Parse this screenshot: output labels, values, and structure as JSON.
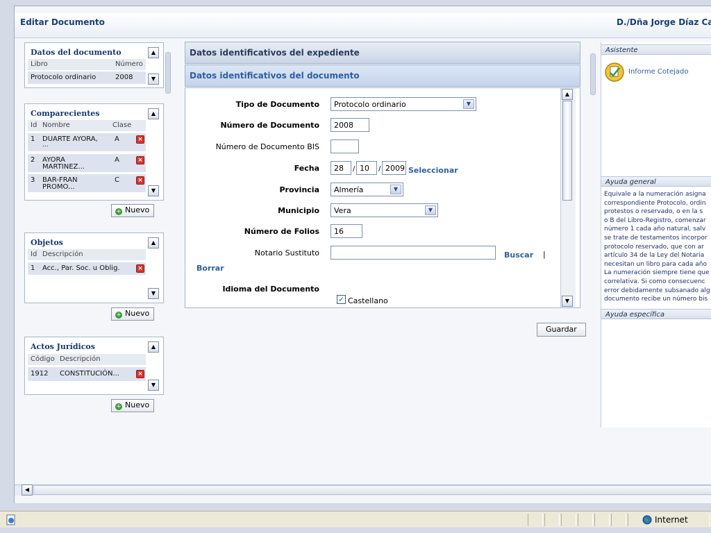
{
  "header": {
    "title": "Editar Documento",
    "user": "D./Dña Jorge Díaz Ca"
  },
  "datos_documento": {
    "title": "Datos del documento",
    "columns": [
      "Libro",
      "Número"
    ],
    "row": {
      "libro": "Protocolo ordinario",
      "numero": "2008"
    }
  },
  "comparecientes": {
    "title": "Comparecientes",
    "columns": [
      "Id",
      "Nombre",
      "Clase"
    ],
    "rows": [
      {
        "id": "1",
        "nombre": "DUARTE AYORA,",
        "nombre2": "...",
        "clase": "A"
      },
      {
        "id": "2",
        "nombre": "AYORA",
        "nombre2": "MARTINEZ...",
        "clase": "A"
      },
      {
        "id": "3",
        "nombre": "BAR-FRAN",
        "nombre2": "PROMO...",
        "clase": "C"
      }
    ],
    "nuevo_label": "Nuevo"
  },
  "objetos": {
    "title": "Objetos",
    "columns": [
      "Id",
      "Descripción"
    ],
    "rows": [
      {
        "id": "1",
        "descripcion": "Acc., Par. Soc. u Oblig."
      }
    ],
    "nuevo_label": "Nuevo"
  },
  "actos": {
    "title": "Actos Jurídicos",
    "columns": [
      "Código",
      "Descripción"
    ],
    "rows": [
      {
        "codigo": "1912",
        "descripcion": "CONSTITUCIÓN..."
      }
    ],
    "nuevo_label": "Nuevo"
  },
  "main": {
    "section1": "Datos identificativos del expediente",
    "section2": "Datos identificativos del documento",
    "form": {
      "tipo_label": "Tipo de Documento",
      "tipo_value": "Protocolo ordinario",
      "numero_label": "Número de Documento",
      "numero_value": "2008",
      "bis_label": "Número de Documento BIS",
      "bis_value": "",
      "fecha_label": "Fecha",
      "fecha_dia": "28",
      "fecha_mes": "10",
      "fecha_anio": "2009",
      "fecha_sep": "/",
      "seleccionar": "Seleccionar",
      "provincia_label": "Provincia",
      "provincia_value": "Almería",
      "municipio_label": "Municipio",
      "municipio_value": "Vera",
      "folios_label": "Número de Folios",
      "folios_value": "16",
      "notario_label": "Notario Sustituto",
      "notario_value": "",
      "buscar": "Buscar",
      "link_sep": "|",
      "borrar": "Borrar",
      "idioma_label": "Idioma del Documento",
      "idioma_option": "Castellano",
      "idioma_checked": true
    },
    "guardar_label": "Guardar"
  },
  "asistente": {
    "title": "Asistente",
    "item": "Informe Cotejado"
  },
  "ayuda_general": {
    "title": "Ayuda general",
    "lines": [
      "Equivale a la numeración asigna",
      "correspondiente Protocolo, ordin",
      "protestos o reservado, o en la s",
      "o B del Libro-Registro, comenzar",
      "número 1 cada año natural, salv",
      "se trate de testamentos incorpor",
      "protocolo reservado, que con ar",
      "artículo 34 de la Ley del Notaria",
      "necesitan un libro para cada año",
      "La numeración siempre tiene que",
      "correlativa. Si como consecuenc",
      "error debidamente subsanado alg",
      "documento recibe un número bis"
    ]
  },
  "ayuda_especifica": {
    "title": "Ayuda específica"
  },
  "statusbar": {
    "zone": "Internet"
  }
}
